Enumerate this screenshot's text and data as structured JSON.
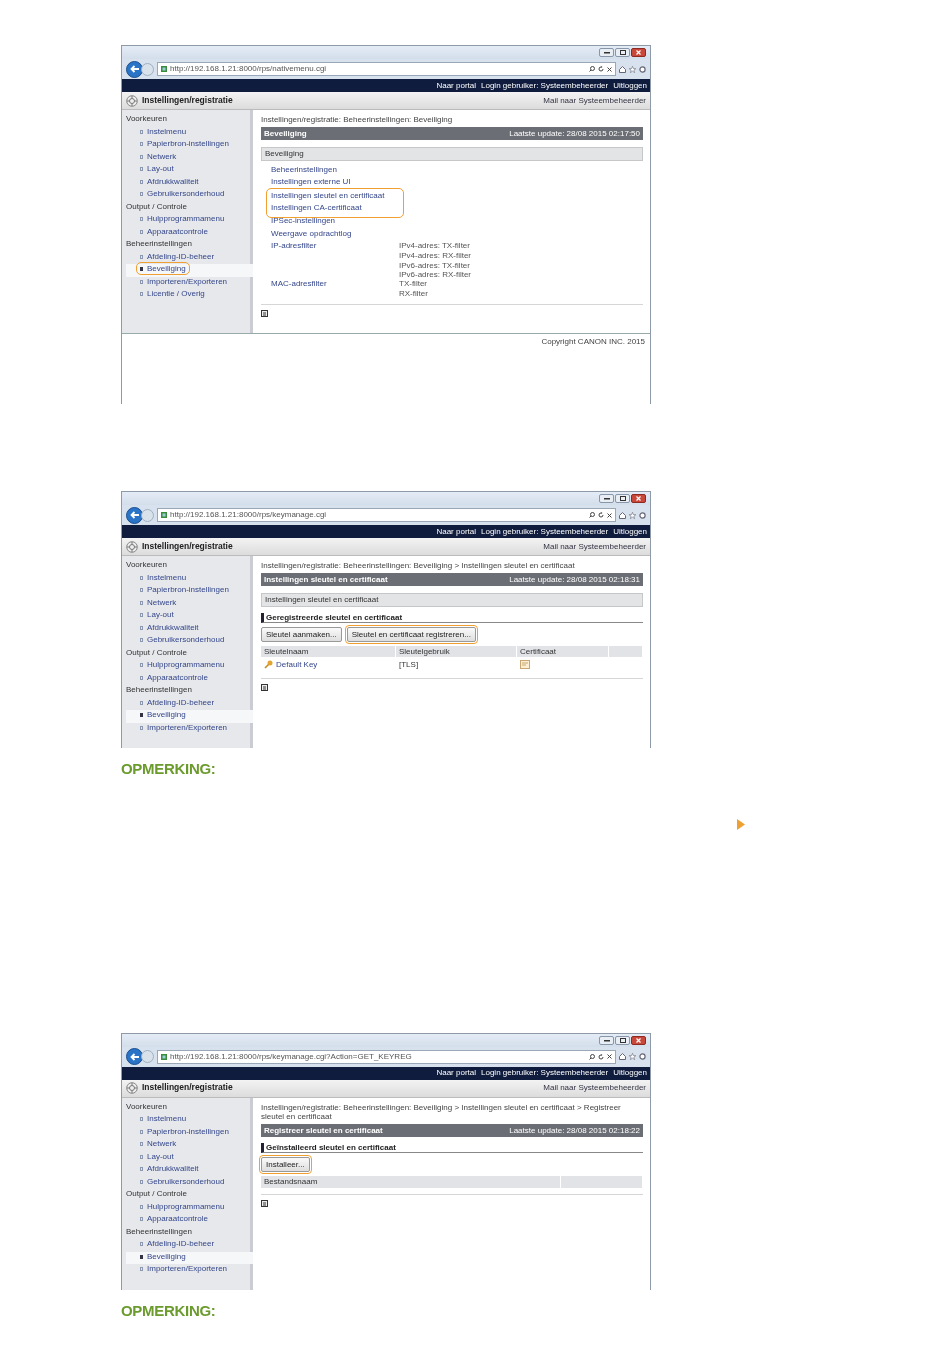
{
  "page": [
    {
      "kind": "screenshot",
      "url": "http://192.168.1.21:8000/rps/nativemenu.cgi",
      "nav_links": [
        "Naar portal",
        "Login gebruiker: Systeembeheerder",
        "Uitloggen"
      ],
      "app_title": "Instellingen/registratie",
      "mail_link": "Mail naar Systeembeheerder",
      "sidebar": [
        {
          "heading": "Voorkeuren",
          "items": [
            {
              "label": "Instelmenu",
              "selected": false,
              "highlighted": false
            },
            {
              "label": "Papierbron-instellingen",
              "selected": false,
              "highlighted": false
            },
            {
              "label": "Netwerk",
              "selected": false,
              "highlighted": false
            },
            {
              "label": "Lay-out",
              "selected": false,
              "highlighted": false
            },
            {
              "label": "Afdrukkwaliteit",
              "selected": false,
              "highlighted": false
            },
            {
              "label": "Gebruikersonderhoud",
              "selected": false,
              "highlighted": false
            }
          ]
        },
        {
          "heading": "Output / Controle",
          "items": [
            {
              "label": "Hulpprogrammamenu",
              "selected": false,
              "highlighted": false
            },
            {
              "label": "Apparaatcontrole",
              "selected": false,
              "highlighted": false
            }
          ]
        },
        {
          "heading": "Beheerinstellingen",
          "items": [
            {
              "label": "Afdeling-ID-beheer",
              "selected": false,
              "highlighted": false
            },
            {
              "label": "Beveiliging",
              "selected": true,
              "highlighted": true
            },
            {
              "label": "Importeren/Exporteren",
              "selected": false,
              "highlighted": false
            },
            {
              "label": "Licentie / Overig",
              "selected": false,
              "highlighted": false
            }
          ]
        }
      ],
      "breadcrumb": "Instellingen/registratie: Beheerinstellingen: Beveiliging",
      "page_title": "Beveiliging",
      "last_update": "Laatste update: 28/08 2015 02:17:50",
      "blocks": [
        {
          "kind": "section",
          "label": "Beveiliging"
        },
        {
          "kind": "links",
          "items": [
            {
              "kind": "link",
              "label": "Beheerinstellingen"
            },
            {
              "kind": "link",
              "label": "Instellingen externe UI"
            },
            {
              "kind": "highlight-group",
              "items": [
                {
                  "kind": "link",
                  "label": "Instellingen sleutel en certificaat"
                },
                {
                  "kind": "link",
                  "label": "Instellingen CA-certificaat"
                }
              ]
            },
            {
              "kind": "link",
              "label": "IPSec-instellingen"
            },
            {
              "kind": "link",
              "label": "Weergave opdrachtlog"
            },
            {
              "kind": "link",
              "label": "IP-adresfilter",
              "details": [
                "IPv4-adres: TX-filter",
                "IPv4-adres: RX-filter",
                "IPv6-adres: TX-filter",
                "IPv6-adres: RX-filter"
              ]
            },
            {
              "kind": "link",
              "label": "MAC-adresfilter",
              "details": [
                "TX-filter",
                "RX-filter"
              ]
            }
          ]
        },
        {
          "kind": "top-icon"
        }
      ],
      "copyright": "Copyright CANON INC. 2015"
    },
    {
      "kind": "screenshot",
      "url": "http://192.168.1.21:8000/rps/keymanage.cgi",
      "nav_links": [
        "Naar portal",
        "Login gebruiker: Systeembeheerder",
        "Uitloggen"
      ],
      "app_title": "Instellingen/registratie",
      "mail_link": "Mail naar Systeembeheerder",
      "sidebar": [
        {
          "heading": "Voorkeuren",
          "items": [
            {
              "label": "Instelmenu",
              "selected": false,
              "highlighted": false
            },
            {
              "label": "Papierbron-instellingen",
              "selected": false,
              "highlighted": false
            },
            {
              "label": "Netwerk",
              "selected": false,
              "highlighted": false
            },
            {
              "label": "Lay-out",
              "selected": false,
              "highlighted": false
            },
            {
              "label": "Afdrukkwaliteit",
              "selected": false,
              "highlighted": false
            },
            {
              "label": "Gebruikersonderhoud",
              "selected": false,
              "highlighted": false
            }
          ]
        },
        {
          "heading": "Output / Controle",
          "items": [
            {
              "label": "Hulpprogrammamenu",
              "selected": false,
              "highlighted": false
            },
            {
              "label": "Apparaatcontrole",
              "selected": false,
              "highlighted": false
            }
          ]
        },
        {
          "heading": "Beheerinstellingen",
          "items": [
            {
              "label": "Afdeling-ID-beheer",
              "selected": false,
              "highlighted": false
            },
            {
              "label": "Beveiliging",
              "selected": true,
              "highlighted": false
            },
            {
              "label": "Importeren/Exporteren",
              "selected": false,
              "highlighted": false
            }
          ]
        }
      ],
      "breadcrumb": "Instellingen/registratie: Beheerinstellingen: Beveiliging > Instellingen sleutel en certificaat",
      "page_title": "Instellingen sleutel en certificaat",
      "last_update": "Laatste update: 28/08 2015 02:18:31",
      "blocks": [
        {
          "kind": "section",
          "label": "Instellingen sleutel en certificaat"
        },
        {
          "kind": "subheading",
          "label": "Geregistreerde sleutel en certificaat"
        },
        {
          "kind": "buttons",
          "items": [
            {
              "label": "Sleutel aanmaken...",
              "highlighted": false
            },
            {
              "label": "Sleutel en certificaat registreren...",
              "highlighted": true
            }
          ]
        },
        {
          "kind": "table",
          "columns": [
            "Sleutelnaam",
            "Sleutelgebruik",
            "Certificaat"
          ],
          "rows": [
            {
              "key": "Default Key",
              "usage": "[TLS]"
            }
          ]
        },
        {
          "kind": "top-icon"
        }
      ]
    },
    {
      "kind": "note",
      "title": "OPMERKING:"
    },
    {
      "kind": "marker"
    },
    {
      "kind": "screenshot",
      "url": "http://192.168.1.21:8000/rps/keymanage.cgi?Action=GET_KEYREG",
      "nav_links": [
        "Naar portal",
        "Login gebruiker: Systeembeheerder",
        "Uitloggen"
      ],
      "app_title": "Instellingen/registratie",
      "mail_link": "Mail naar Systeembeheerder",
      "sidebar": [
        {
          "heading": "Voorkeuren",
          "items": [
            {
              "label": "Instelmenu",
              "selected": false,
              "highlighted": false
            },
            {
              "label": "Papierbron-instellingen",
              "selected": false,
              "highlighted": false
            },
            {
              "label": "Netwerk",
              "selected": false,
              "highlighted": false
            },
            {
              "label": "Lay-out",
              "selected": false,
              "highlighted": false
            },
            {
              "label": "Afdrukkwaliteit",
              "selected": false,
              "highlighted": false
            },
            {
              "label": "Gebruikersonderhoud",
              "selected": false,
              "highlighted": false
            }
          ]
        },
        {
          "heading": "Output / Controle",
          "items": [
            {
              "label": "Hulpprogrammamenu",
              "selected": false,
              "highlighted": false
            },
            {
              "label": "Apparaatcontrole",
              "selected": false,
              "highlighted": false
            }
          ]
        },
        {
          "heading": "Beheerinstellingen",
          "items": [
            {
              "label": "Afdeling-ID-beheer",
              "selected": false,
              "highlighted": false
            },
            {
              "label": "Beveiliging",
              "selected": true,
              "highlighted": false
            },
            {
              "label": "Importeren/Exporteren",
              "selected": false,
              "highlighted": false
            }
          ]
        }
      ],
      "breadcrumb": "Instellingen/registratie: Beheerinstellingen: Beveiliging > Instellingen sleutel en certificaat > Registreer sleutel en certificaat",
      "page_title": "Registreer sleutel en certificaat",
      "last_update": "Laatste update: 28/08 2015 02:18:22",
      "blocks": [
        {
          "kind": "subheading",
          "label": "Geïnstalleerd sleutel en certificaat"
        },
        {
          "kind": "buttons",
          "items": [
            {
              "label": "Installeer...",
              "highlighted": true
            }
          ]
        },
        {
          "kind": "table",
          "columns": [
            "Bestandsnaam"
          ]
        },
        {
          "kind": "top-icon"
        }
      ]
    },
    {
      "kind": "note",
      "title": "OPMERKING:"
    }
  ]
}
